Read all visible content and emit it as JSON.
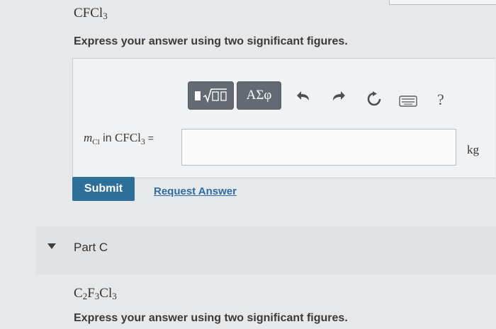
{
  "part_b": {
    "formula": {
      "main": "CFCl",
      "sub": "3"
    },
    "instruction": "Express your answer using two significant figures.",
    "toolbar": {
      "template_icon": "fraction-root-template-icon",
      "symbols_label": "ΑΣφ",
      "undo_icon": "undo-icon",
      "redo_icon": "redo-icon",
      "reset_icon": "reset-icon",
      "keyboard_icon": "keyboard-icon",
      "help_label": "?"
    },
    "answer": {
      "var": "m",
      "var_sub": "Cl",
      "in_text": " in ",
      "compound": "CFCl",
      "compound_sub": "3",
      "equals": " =",
      "value": "",
      "unit": "kg"
    },
    "submit_label": "Submit",
    "request_label": "Request Answer"
  },
  "part_c": {
    "title": "Part C",
    "formula": {
      "c": "C",
      "c_sub": "2",
      "f": "F",
      "f_sub": "3",
      "cl": "Cl",
      "cl_sub": "3"
    },
    "instruction": "Express your answer using two significant figures."
  }
}
